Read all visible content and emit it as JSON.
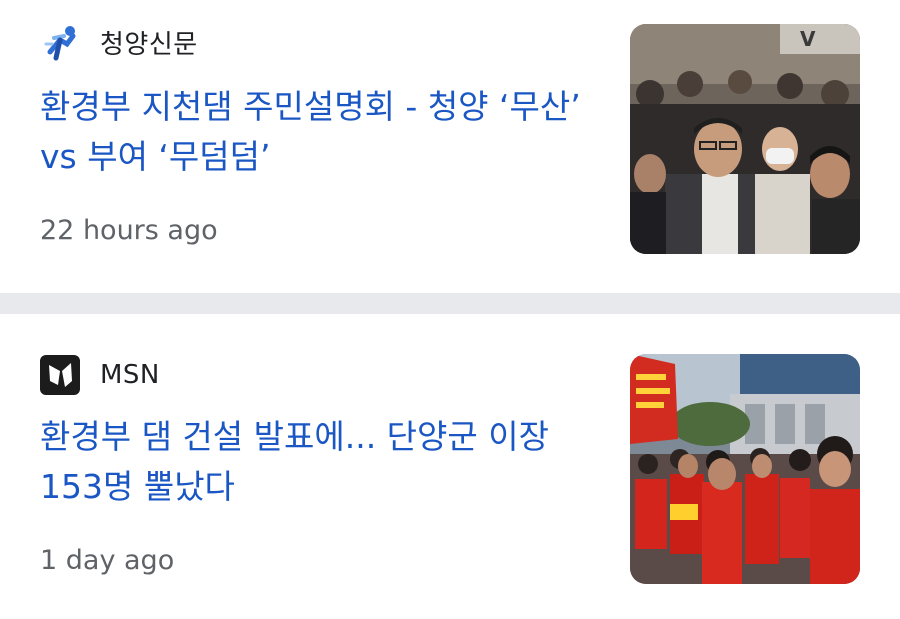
{
  "articles": [
    {
      "source": "청양신문",
      "source_icon": "runner-logo-icon",
      "headline": "환경부 지천댐 주민설명회 - 청양 ‘무산’ vs 부여 ‘무덤덤’",
      "age": "22 hours ago",
      "thumbnail": "crowd-photo"
    },
    {
      "source": "MSN",
      "source_icon": "msn-butterfly-icon",
      "headline": "환경부 댐 건설 발표에... 단양군 이장 153명 뿔났다",
      "age": "1 day ago",
      "thumbnail": "protest-photo"
    }
  ],
  "colors": {
    "headline": "#1a56c4",
    "divider": "#e8e9ec",
    "secondary_text": "#5f6368"
  }
}
